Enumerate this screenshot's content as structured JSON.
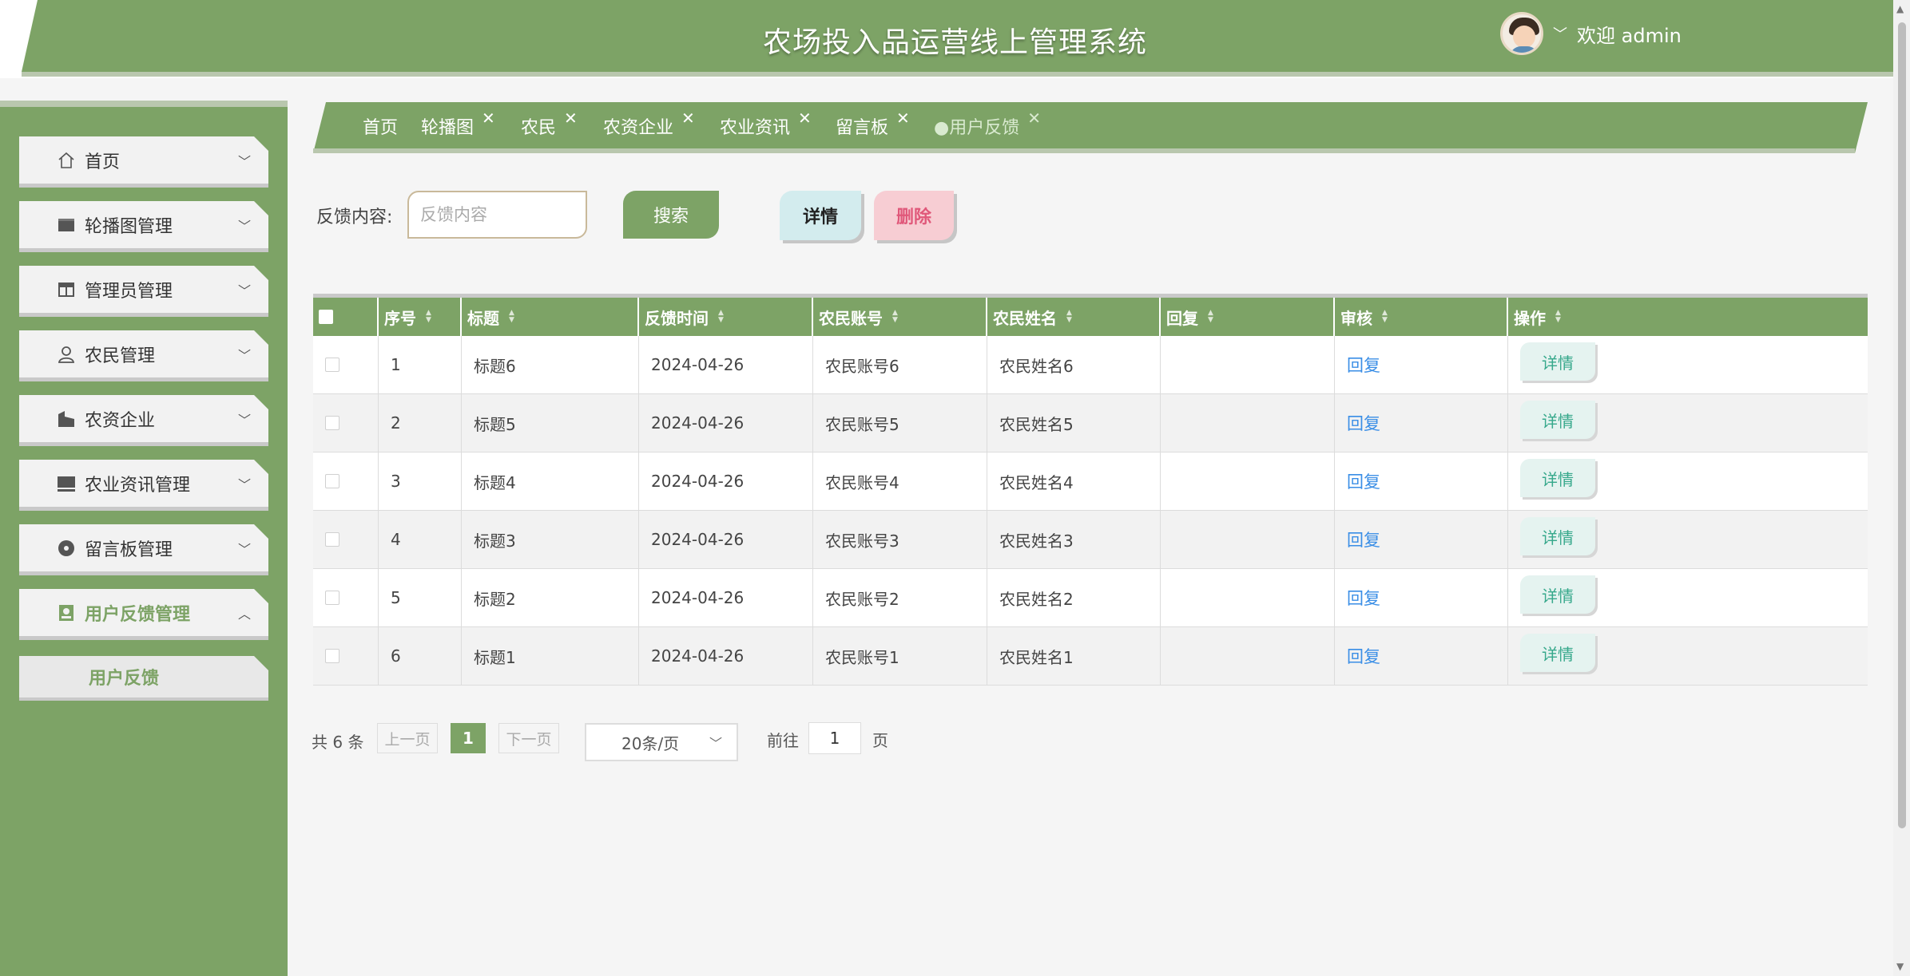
{
  "header": {
    "title": "农场投入品运营线上管理系统",
    "welcome": "欢迎 admin"
  },
  "sidebar": {
    "items": [
      {
        "label": "首页",
        "icon": "home-icon"
      },
      {
        "label": "轮播图管理",
        "icon": "image-icon"
      },
      {
        "label": "管理员管理",
        "icon": "layout-icon"
      },
      {
        "label": "农民管理",
        "icon": "user-icon"
      },
      {
        "label": "农资企业",
        "icon": "building-icon"
      },
      {
        "label": "农业资讯管理",
        "icon": "monitor-icon"
      },
      {
        "label": "留言板管理",
        "icon": "disc-icon"
      },
      {
        "label": "用户反馈管理",
        "icon": "badge-icon"
      }
    ],
    "submenu": "用户反馈"
  },
  "tabs": [
    {
      "label": "首页"
    },
    {
      "label": "轮播图"
    },
    {
      "label": "农民"
    },
    {
      "label": "农资企业"
    },
    {
      "label": "农业资讯"
    },
    {
      "label": "留言板"
    },
    {
      "label": "●用户反馈"
    }
  ],
  "search": {
    "label": "反馈内容:",
    "placeholder": "反馈内容",
    "search_button": "搜索",
    "detail_button": "详情",
    "delete_button": "删除"
  },
  "table": {
    "columns": [
      "序号",
      "标题",
      "反馈时间",
      "农民账号",
      "农民姓名",
      "回复",
      "审核",
      "操作"
    ],
    "rows": [
      {
        "no": "1",
        "title": "标题6",
        "time": "2024-04-26",
        "account": "农民账号6",
        "name": "农民姓名6",
        "reply": "",
        "audit": "回复",
        "action": "详情"
      },
      {
        "no": "2",
        "title": "标题5",
        "time": "2024-04-26",
        "account": "农民账号5",
        "name": "农民姓名5",
        "reply": "",
        "audit": "回复",
        "action": "详情"
      },
      {
        "no": "3",
        "title": "标题4",
        "time": "2024-04-26",
        "account": "农民账号4",
        "name": "农民姓名4",
        "reply": "",
        "audit": "回复",
        "action": "详情"
      },
      {
        "no": "4",
        "title": "标题3",
        "time": "2024-04-26",
        "account": "农民账号3",
        "name": "农民姓名3",
        "reply": "",
        "audit": "回复",
        "action": "详情"
      },
      {
        "no": "5",
        "title": "标题2",
        "time": "2024-04-26",
        "account": "农民账号2",
        "name": "农民姓名2",
        "reply": "",
        "audit": "回复",
        "action": "详情"
      },
      {
        "no": "6",
        "title": "标题1",
        "time": "2024-04-26",
        "account": "农民账号1",
        "name": "农民姓名1",
        "reply": "",
        "audit": "回复",
        "action": "详情"
      }
    ]
  },
  "pagination": {
    "total": "共 6 条",
    "prev": "上一页",
    "current": "1",
    "next": "下一页",
    "page_size": "20条/页",
    "goto": "前往",
    "goto_value": "1",
    "page_unit": "页"
  },
  "colors": {
    "primary": "#7da366",
    "link": "#3a8ee6",
    "delete": "#e0587a"
  }
}
